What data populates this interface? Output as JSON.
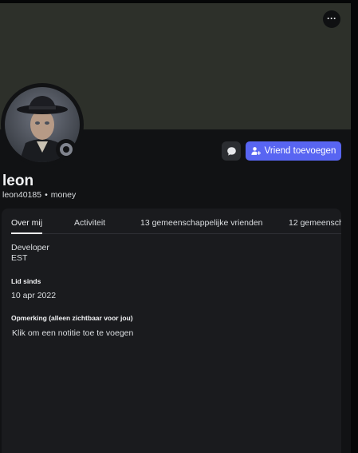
{
  "profile": {
    "display_name": "leon",
    "username": "leon40185",
    "separator": "•",
    "pronouns": "money",
    "status": "offline"
  },
  "actions": {
    "message_icon": "chat-bubble-icon",
    "add_friend_label": "Vriend toevoegen",
    "add_friend_icon": "add-user-icon",
    "more_icon": "ellipsis-icon",
    "more_label": "···"
  },
  "tabs": [
    {
      "label": "Over mij",
      "active": true
    },
    {
      "label": "Activiteit",
      "active": false
    },
    {
      "label": "13 gemeenschappelijke vrienden",
      "active": false
    },
    {
      "label": "12 gemeenscha",
      "active": false
    }
  ],
  "about": {
    "bio_line1": "Developer",
    "bio_line2": "EST",
    "member_since_heading": "Lid sinds",
    "member_since": "10 apr 2022",
    "note_heading": "Opmerking (alleen zichtbaar voor jou)",
    "note_placeholder": "Klik om een notitie toe te voegen"
  },
  "colors": {
    "banner": "#2d302a",
    "accent": "#5865f2",
    "panel": "#1a1b1e",
    "status_offline": "#80848e"
  }
}
